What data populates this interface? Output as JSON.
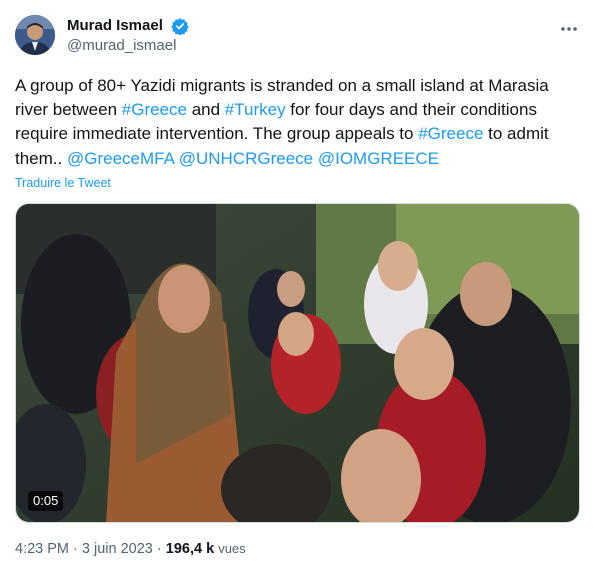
{
  "author": {
    "display_name": "Murad Ismael",
    "handle": "@murad_ismael"
  },
  "tweet": {
    "segments": [
      {
        "text": "A group of 80+ Yazidi migrants is stranded  on a small island at Marasia river between ",
        "link": false
      },
      {
        "text": "#Greece",
        "link": true
      },
      {
        "text": " and ",
        "link": false
      },
      {
        "text": "#Turkey",
        "link": true
      },
      {
        "text": " for four days and their conditions require immediate intervention. The group appeals to ",
        "link": false
      },
      {
        "text": "#Greece",
        "link": true
      },
      {
        "text": " to admit them.. ",
        "link": false
      },
      {
        "text": "@GreeceMFA",
        "link": true
      },
      {
        "text": " ",
        "link": false
      },
      {
        "text": "@UNHCRGreece",
        "link": true
      },
      {
        "text": " ",
        "link": false
      },
      {
        "text": "@IOMGREECE",
        "link": true
      }
    ],
    "translate_label": "Traduire le Tweet",
    "video_duration": "0:05",
    "time": "4:23 PM",
    "date": "3 juin 2023",
    "separator": "·",
    "views_count": "196,4 k",
    "views_label": "vues"
  },
  "colors": {
    "link": "#1d9bf0",
    "verified": "#1d9bf0",
    "secondary_text": "#536471"
  },
  "icons": {
    "verified": "verified-badge-icon",
    "more": "more-horizontal-icon"
  }
}
